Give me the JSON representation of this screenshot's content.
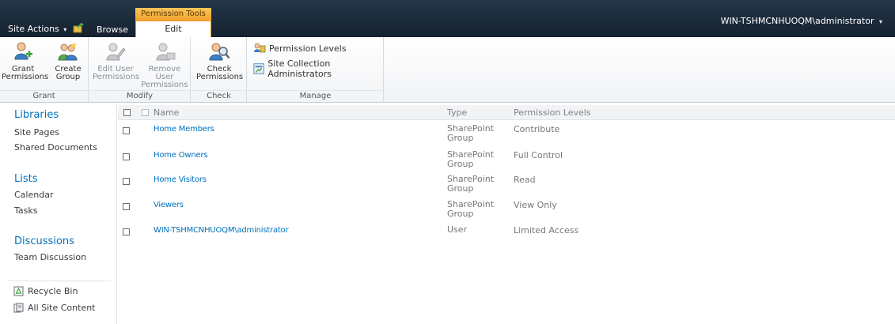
{
  "topbar": {
    "site_actions": "Site Actions",
    "site_actions_caret": "▾",
    "browse_tab": "Browse",
    "contextual_group": "Permission Tools",
    "edit_tab": "Edit",
    "user": "WIN-TSHMCNHUOQM\\administrator",
    "user_caret": "▾"
  },
  "ribbon": {
    "groups": [
      {
        "label": "Grant",
        "buttons": [
          {
            "label_line1": "Grant",
            "label_line2": "Permissions",
            "icon": "grant-permissions-icon"
          },
          {
            "label_line1": "Create",
            "label_line2": "Group",
            "icon": "create-group-icon"
          }
        ]
      },
      {
        "label": "Modify",
        "buttons": [
          {
            "label_line1": "Edit User",
            "label_line2": "Permissions",
            "icon": "edit-user-permissions-icon"
          },
          {
            "label_line1": "Remove User",
            "label_line2": "Permissions",
            "icon": "remove-user-permissions-icon"
          }
        ]
      },
      {
        "label": "Check",
        "buttons": [
          {
            "label_line1": "Check",
            "label_line2": "Permissions",
            "icon": "check-permissions-icon"
          }
        ]
      },
      {
        "label": "Manage",
        "buttons": [
          {
            "label": "Permission Levels",
            "icon": "permission-levels-icon"
          },
          {
            "label": "Site Collection Administrators",
            "icon": "site-collection-administrators-icon"
          }
        ]
      }
    ]
  },
  "leftnav": {
    "sections": [
      {
        "heading": "Libraries",
        "items": [
          "Site Pages",
          "Shared Documents"
        ]
      },
      {
        "heading": "Lists",
        "items": [
          "Calendar",
          "Tasks"
        ]
      },
      {
        "heading": "Discussions",
        "items": [
          "Team Discussion"
        ]
      }
    ],
    "utilities": [
      {
        "label": "Recycle Bin",
        "icon": "recycle-bin-icon"
      },
      {
        "label": "All Site Content",
        "icon": "all-site-content-icon"
      }
    ]
  },
  "table": {
    "columns": [
      "Name",
      "Type",
      "Permission Levels"
    ],
    "rows": [
      {
        "name": "Home Members",
        "type_line1": "SharePoint",
        "type_line2": "Group",
        "permission": "Contribute"
      },
      {
        "name": "Home Owners",
        "type_line1": "SharePoint",
        "type_line2": "Group",
        "permission": "Full Control"
      },
      {
        "name": "Home Visitors",
        "type_line1": "SharePoint",
        "type_line2": "Group",
        "permission": "Read"
      },
      {
        "name": "Viewers",
        "type_line1": "SharePoint",
        "type_line2": "Group",
        "permission": "View Only"
      },
      {
        "name": "WIN-TSHMCNHUOQM\\administrator",
        "type_line1": "User",
        "type_line2": "",
        "permission": "Limited Access"
      }
    ]
  },
  "colors": {
    "topbar": "#1b2b3d",
    "accent_orange": "#f2a12d",
    "link_blue": "#0072bc"
  }
}
